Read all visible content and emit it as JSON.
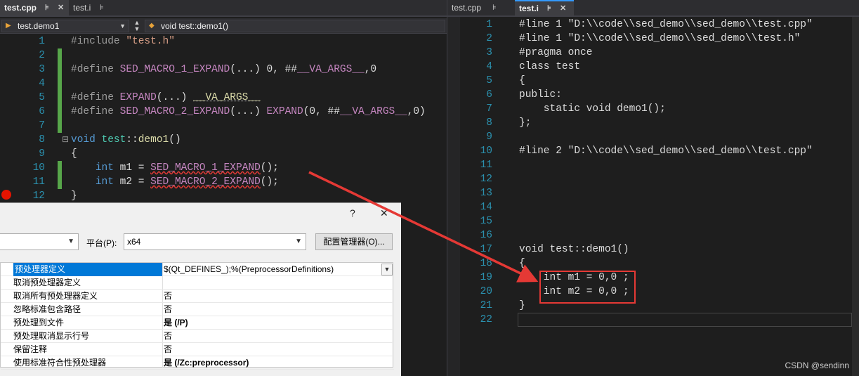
{
  "left_editor": {
    "tabs": [
      {
        "label": "test.cpp",
        "pin": "⊧",
        "close": "✕"
      },
      {
        "label": "test.i",
        "pin": "⊧"
      }
    ],
    "nav": {
      "scope": "test.demo1",
      "member": "void test::demo1()"
    },
    "line_numbers": [
      "1",
      "2",
      "3",
      "4",
      "5",
      "6",
      "7",
      "8",
      "9",
      "10",
      "11",
      "12"
    ],
    "lines": {
      "l1_a": "#include ",
      "l1_b": "\"test.h\"",
      "l3_a": "#define ",
      "l3_b": "SED_MACRO_1_EXPAND",
      "l3_c": "(...) ",
      "l3_d": "0",
      "l3_e": ", ##",
      "l3_f": "__VA_ARGS__",
      "l3_g": ",0",
      "l5_a": "#define ",
      "l5_b": "EXPAND",
      "l5_c": "(...) ",
      "l5_d": "__VA_ARGS__",
      "l6_a": "#define ",
      "l6_b": "SED_MACRO_2_EXPAND",
      "l6_c": "(...) ",
      "l6_d": "EXPAND",
      "l6_e": "(0, ##",
      "l6_f": "__VA_ARGS__",
      "l6_g": ",0)",
      "l8_a": "void ",
      "l8_b": "test",
      "l8_c": "::",
      "l8_d": "demo1",
      "l8_e": "()",
      "l9": "{",
      "l10_a": "int ",
      "l10_b": "m1 = ",
      "l10_c": "SED_MACRO_1_EXPAND",
      "l10_d": "();",
      "l11_a": "int ",
      "l11_b": "m2 = ",
      "l11_c": "SED_MACRO_2_EXPAND",
      "l11_d": "();",
      "l12": "}"
    }
  },
  "dialog": {
    "help": "?",
    "close": "✕",
    "platform_label": "平台(P):",
    "platform_value": "x64",
    "config_manager": "配置管理器(O)...",
    "properties": [
      {
        "name": "预处理器定义",
        "value": "$(Qt_DEFINES_);%(PreprocessorDefinitions)"
      },
      {
        "name": "取消预处理器定义",
        "value": ""
      },
      {
        "name": "取消所有预处理器定义",
        "value": "否"
      },
      {
        "name": "忽略标准包含路径",
        "value": "否"
      },
      {
        "name": "预处理到文件",
        "value": "是 (/P)"
      },
      {
        "name": "预处理取消显示行号",
        "value": "否"
      },
      {
        "name": "保留注释",
        "value": "否"
      },
      {
        "name": "使用标准符合性预处理器",
        "value": "是 (/Zc:preprocessor)"
      }
    ]
  },
  "right_editor": {
    "tabs": [
      {
        "label": "test.cpp",
        "pin": "⊧"
      },
      {
        "label": "test.i",
        "pin": "⊧",
        "close": "✕"
      }
    ],
    "line_numbers": [
      "1",
      "2",
      "3",
      "4",
      "5",
      "6",
      "7",
      "8",
      "9",
      "10",
      "11",
      "12",
      "13",
      "14",
      "15",
      "16",
      "17",
      "18",
      "19",
      "20",
      "21",
      "22"
    ],
    "lines": [
      "#line 1 \"D:\\\\code\\\\sed_demo\\\\sed_demo\\\\test.cpp\"",
      "#line 1 \"D:\\\\code\\\\sed_demo\\\\sed_demo\\\\test.h\"",
      "#pragma once",
      "class test",
      "{",
      "public:",
      "    static void demo1();",
      "};",
      "",
      "#line 2 \"D:\\\\code\\\\sed_demo\\\\sed_demo\\\\test.cpp\"",
      "",
      "",
      "",
      "",
      "",
      "",
      "void test::demo1()",
      "{",
      "    int m1 = 0,0 ;",
      "    int m2 = 0,0 ;",
      "}",
      ""
    ]
  },
  "watermark": "CSDN @sendinn",
  "colors": {
    "highlight": "#e53935",
    "arrow": "#e53935"
  }
}
